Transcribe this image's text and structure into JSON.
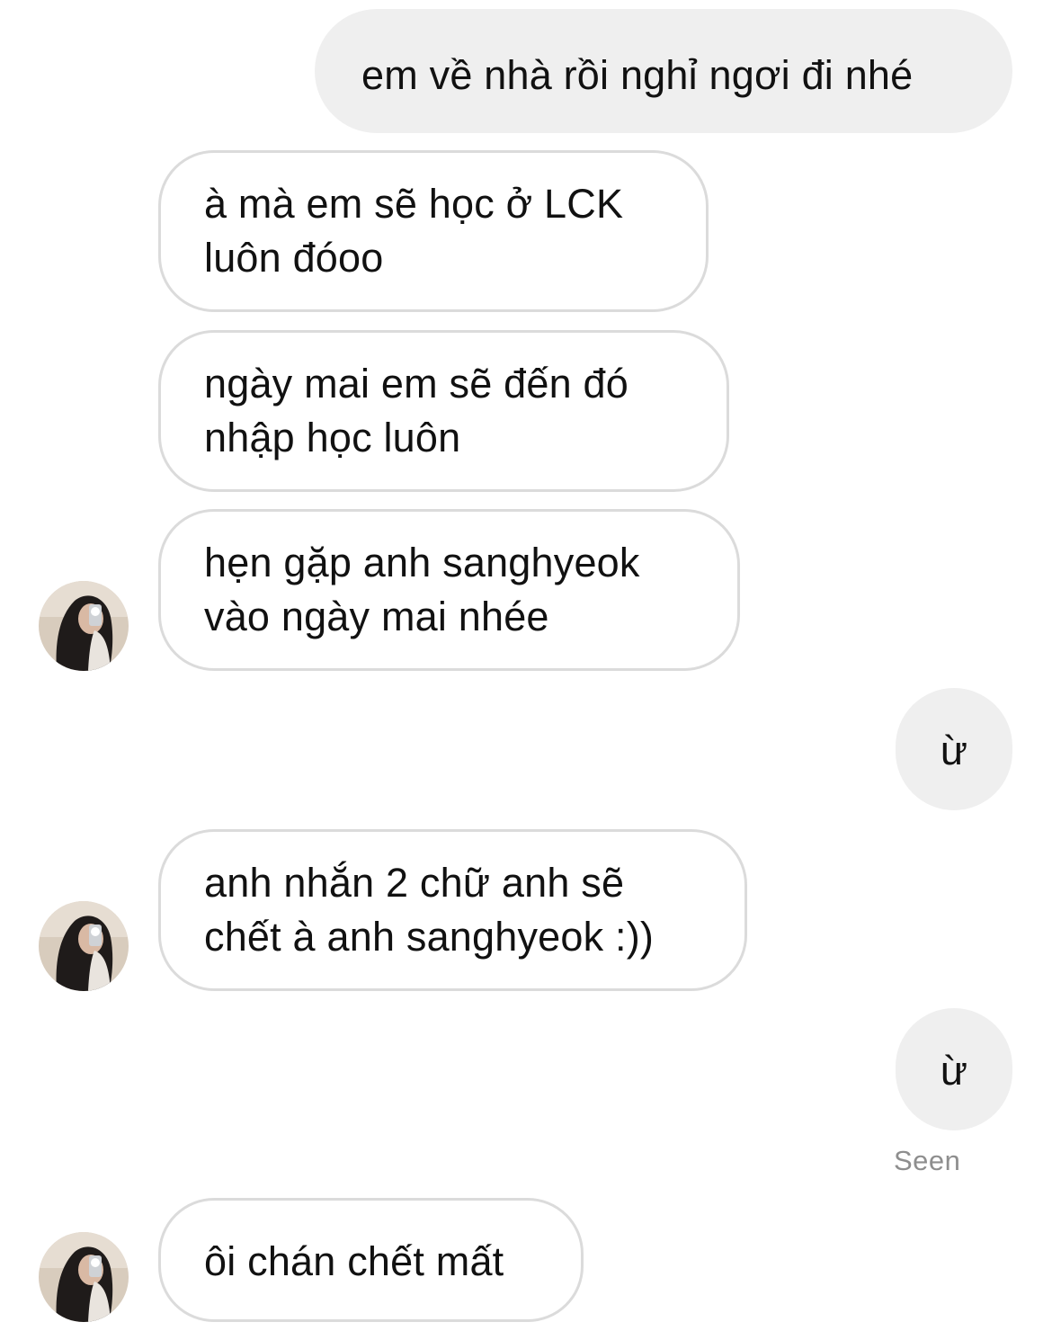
{
  "conversation": {
    "messages": [
      {
        "sender": "me",
        "lines": [
          "em về nhà rồi nghỉ ngơi đi nhé"
        ]
      },
      {
        "sender": "them",
        "lines": [
          "à mà em sẽ học ở LCK",
          "luôn đóoo"
        ]
      },
      {
        "sender": "them",
        "lines": [
          "ngày mai em sẽ đến đó",
          "nhập học luôn"
        ]
      },
      {
        "sender": "them",
        "lines": [
          "hẹn gặp anh sanghyeok",
          "vào ngày mai nhée"
        ]
      },
      {
        "sender": "me",
        "lines": [
          "ừ"
        ]
      },
      {
        "sender": "them",
        "lines": [
          "anh nhắn 2 chữ anh sẽ",
          "chết à anh sanghyeok :))"
        ]
      },
      {
        "sender": "me",
        "lines": [
          "ừ"
        ]
      },
      {
        "sender": "them",
        "lines": [
          "ôi chán chết mất"
        ]
      }
    ],
    "seen_label": "Seen",
    "avatar_icon": "profile-photo-avatar",
    "colors": {
      "outgoing_bubble": "#efefef",
      "incoming_border": "#dbdbdb",
      "text": "#111111",
      "seen_text": "#8e8e8e"
    }
  }
}
